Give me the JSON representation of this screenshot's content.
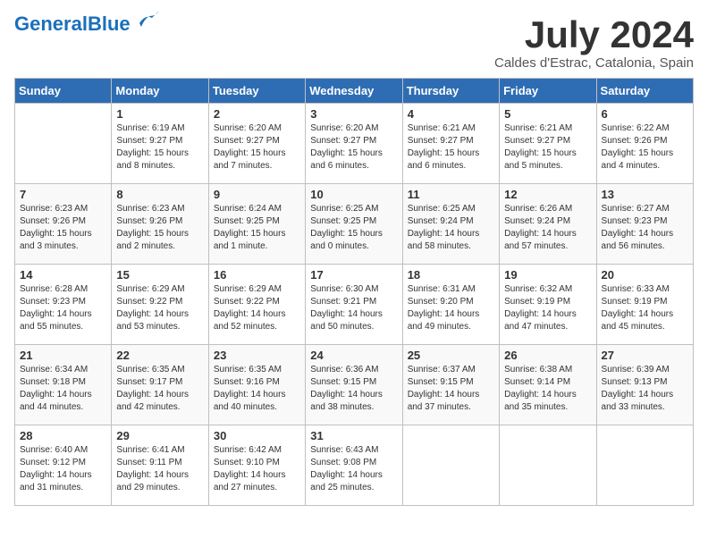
{
  "header": {
    "logo_general": "General",
    "logo_blue": "Blue",
    "month_title": "July 2024",
    "location": "Caldes d'Estrac, Catalonia, Spain"
  },
  "weekdays": [
    "Sunday",
    "Monday",
    "Tuesday",
    "Wednesday",
    "Thursday",
    "Friday",
    "Saturday"
  ],
  "weeks": [
    [
      {
        "day": "",
        "sunrise": "",
        "sunset": "",
        "daylight": ""
      },
      {
        "day": "1",
        "sunrise": "Sunrise: 6:19 AM",
        "sunset": "Sunset: 9:27 PM",
        "daylight": "Daylight: 15 hours and 8 minutes."
      },
      {
        "day": "2",
        "sunrise": "Sunrise: 6:20 AM",
        "sunset": "Sunset: 9:27 PM",
        "daylight": "Daylight: 15 hours and 7 minutes."
      },
      {
        "day": "3",
        "sunrise": "Sunrise: 6:20 AM",
        "sunset": "Sunset: 9:27 PM",
        "daylight": "Daylight: 15 hours and 6 minutes."
      },
      {
        "day": "4",
        "sunrise": "Sunrise: 6:21 AM",
        "sunset": "Sunset: 9:27 PM",
        "daylight": "Daylight: 15 hours and 6 minutes."
      },
      {
        "day": "5",
        "sunrise": "Sunrise: 6:21 AM",
        "sunset": "Sunset: 9:27 PM",
        "daylight": "Daylight: 15 hours and 5 minutes."
      },
      {
        "day": "6",
        "sunrise": "Sunrise: 6:22 AM",
        "sunset": "Sunset: 9:26 PM",
        "daylight": "Daylight: 15 hours and 4 minutes."
      }
    ],
    [
      {
        "day": "7",
        "sunrise": "Sunrise: 6:23 AM",
        "sunset": "Sunset: 9:26 PM",
        "daylight": "Daylight: 15 hours and 3 minutes."
      },
      {
        "day": "8",
        "sunrise": "Sunrise: 6:23 AM",
        "sunset": "Sunset: 9:26 PM",
        "daylight": "Daylight: 15 hours and 2 minutes."
      },
      {
        "day": "9",
        "sunrise": "Sunrise: 6:24 AM",
        "sunset": "Sunset: 9:25 PM",
        "daylight": "Daylight: 15 hours and 1 minute."
      },
      {
        "day": "10",
        "sunrise": "Sunrise: 6:25 AM",
        "sunset": "Sunset: 9:25 PM",
        "daylight": "Daylight: 15 hours and 0 minutes."
      },
      {
        "day": "11",
        "sunrise": "Sunrise: 6:25 AM",
        "sunset": "Sunset: 9:24 PM",
        "daylight": "Daylight: 14 hours and 58 minutes."
      },
      {
        "day": "12",
        "sunrise": "Sunrise: 6:26 AM",
        "sunset": "Sunset: 9:24 PM",
        "daylight": "Daylight: 14 hours and 57 minutes."
      },
      {
        "day": "13",
        "sunrise": "Sunrise: 6:27 AM",
        "sunset": "Sunset: 9:23 PM",
        "daylight": "Daylight: 14 hours and 56 minutes."
      }
    ],
    [
      {
        "day": "14",
        "sunrise": "Sunrise: 6:28 AM",
        "sunset": "Sunset: 9:23 PM",
        "daylight": "Daylight: 14 hours and 55 minutes."
      },
      {
        "day": "15",
        "sunrise": "Sunrise: 6:29 AM",
        "sunset": "Sunset: 9:22 PM",
        "daylight": "Daylight: 14 hours and 53 minutes."
      },
      {
        "day": "16",
        "sunrise": "Sunrise: 6:29 AM",
        "sunset": "Sunset: 9:22 PM",
        "daylight": "Daylight: 14 hours and 52 minutes."
      },
      {
        "day": "17",
        "sunrise": "Sunrise: 6:30 AM",
        "sunset": "Sunset: 9:21 PM",
        "daylight": "Daylight: 14 hours and 50 minutes."
      },
      {
        "day": "18",
        "sunrise": "Sunrise: 6:31 AM",
        "sunset": "Sunset: 9:20 PM",
        "daylight": "Daylight: 14 hours and 49 minutes."
      },
      {
        "day": "19",
        "sunrise": "Sunrise: 6:32 AM",
        "sunset": "Sunset: 9:19 PM",
        "daylight": "Daylight: 14 hours and 47 minutes."
      },
      {
        "day": "20",
        "sunrise": "Sunrise: 6:33 AM",
        "sunset": "Sunset: 9:19 PM",
        "daylight": "Daylight: 14 hours and 45 minutes."
      }
    ],
    [
      {
        "day": "21",
        "sunrise": "Sunrise: 6:34 AM",
        "sunset": "Sunset: 9:18 PM",
        "daylight": "Daylight: 14 hours and 44 minutes."
      },
      {
        "day": "22",
        "sunrise": "Sunrise: 6:35 AM",
        "sunset": "Sunset: 9:17 PM",
        "daylight": "Daylight: 14 hours and 42 minutes."
      },
      {
        "day": "23",
        "sunrise": "Sunrise: 6:35 AM",
        "sunset": "Sunset: 9:16 PM",
        "daylight": "Daylight: 14 hours and 40 minutes."
      },
      {
        "day": "24",
        "sunrise": "Sunrise: 6:36 AM",
        "sunset": "Sunset: 9:15 PM",
        "daylight": "Daylight: 14 hours and 38 minutes."
      },
      {
        "day": "25",
        "sunrise": "Sunrise: 6:37 AM",
        "sunset": "Sunset: 9:15 PM",
        "daylight": "Daylight: 14 hours and 37 minutes."
      },
      {
        "day": "26",
        "sunrise": "Sunrise: 6:38 AM",
        "sunset": "Sunset: 9:14 PM",
        "daylight": "Daylight: 14 hours and 35 minutes."
      },
      {
        "day": "27",
        "sunrise": "Sunrise: 6:39 AM",
        "sunset": "Sunset: 9:13 PM",
        "daylight": "Daylight: 14 hours and 33 minutes."
      }
    ],
    [
      {
        "day": "28",
        "sunrise": "Sunrise: 6:40 AM",
        "sunset": "Sunset: 9:12 PM",
        "daylight": "Daylight: 14 hours and 31 minutes."
      },
      {
        "day": "29",
        "sunrise": "Sunrise: 6:41 AM",
        "sunset": "Sunset: 9:11 PM",
        "daylight": "Daylight: 14 hours and 29 minutes."
      },
      {
        "day": "30",
        "sunrise": "Sunrise: 6:42 AM",
        "sunset": "Sunset: 9:10 PM",
        "daylight": "Daylight: 14 hours and 27 minutes."
      },
      {
        "day": "31",
        "sunrise": "Sunrise: 6:43 AM",
        "sunset": "Sunset: 9:08 PM",
        "daylight": "Daylight: 14 hours and 25 minutes."
      },
      {
        "day": "",
        "sunrise": "",
        "sunset": "",
        "daylight": ""
      },
      {
        "day": "",
        "sunrise": "",
        "sunset": "",
        "daylight": ""
      },
      {
        "day": "",
        "sunrise": "",
        "sunset": "",
        "daylight": ""
      }
    ]
  ]
}
